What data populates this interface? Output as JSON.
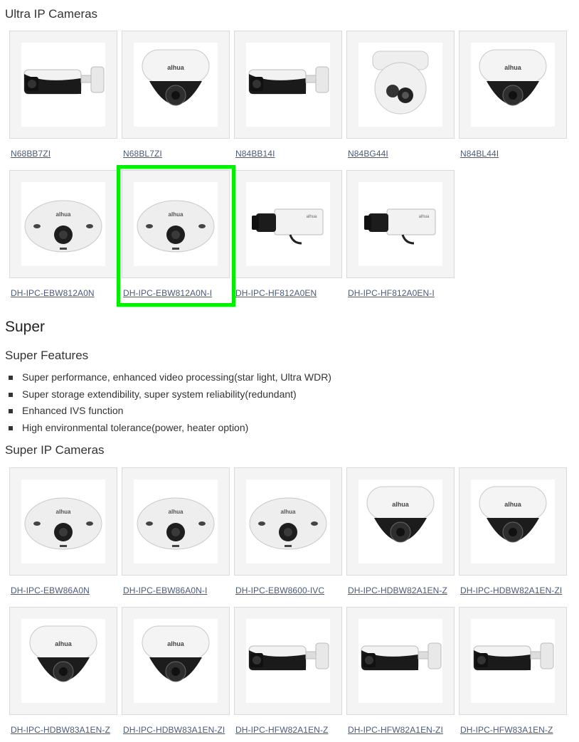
{
  "ultra": {
    "title": "Ultra IP Cameras",
    "cameras": [
      {
        "label": "N68BB7ZI",
        "icon": "bullet-camera-icon"
      },
      {
        "label": "N68BL7ZI",
        "icon": "dome-camera-icon"
      },
      {
        "label": "N84BB14I",
        "icon": "bullet-camera-icon"
      },
      {
        "label": "N84BG44I",
        "icon": "eyeball-camera-icon"
      },
      {
        "label": "N84BL44I",
        "icon": "dome-camera-icon"
      },
      {
        "label": "DH-IPC-EBW812A0N",
        "icon": "fisheye-camera-icon"
      },
      {
        "label": "DH-IPC-EBW812A0N-I",
        "icon": "fisheye-camera-icon"
      },
      {
        "label": "DH-IPC-HF812A0EN",
        "icon": "box-camera-icon"
      },
      {
        "label": "DH-IPC-HF812A0EN-I",
        "icon": "box-camera-icon"
      }
    ]
  },
  "super": {
    "heading": "Super",
    "features_title": "Super Features",
    "features": [
      "Super performance, enhanced video processing(star light, Ultra WDR)",
      "Super storage extendibility, super system reliability(redundant)",
      "Enhanced IVS function",
      "High environmental tolerance(power, heater option)"
    ],
    "cameras_title": "Super IP Cameras",
    "cameras": [
      {
        "label": "DH-IPC-EBW86A0N",
        "icon": "fisheye-camera-icon"
      },
      {
        "label": "DH-IPC-EBW86A0N-I",
        "icon": "fisheye-camera-icon"
      },
      {
        "label": "DH-IPC-EBW8600-IVC",
        "icon": "fisheye-camera-icon"
      },
      {
        "label": "DH-IPC-HDBW82A1EN-Z",
        "icon": "dome-camera-icon"
      },
      {
        "label": "DH-IPC-HDBW82A1EN-ZI",
        "icon": "dome-camera-icon"
      },
      {
        "label": "DH-IPC-HDBW83A1EN-Z",
        "icon": "dome-camera-icon"
      },
      {
        "label": "DH-IPC-HDBW83A1EN-ZI",
        "icon": "dome-camera-icon"
      },
      {
        "label": "DH-IPC-HFW82A1EN-Z",
        "icon": "bullet-camera-icon"
      },
      {
        "label": "DH-IPC-HFW82A1EN-ZI",
        "icon": "bullet-camera-icon"
      },
      {
        "label": "DH-IPC-HFW83A1EN-Z",
        "icon": "bullet-camera-icon"
      }
    ]
  },
  "brand_mark": "alhua",
  "colors": {
    "highlight": "#00ee00",
    "link": "#4a5a7a",
    "tile_border": "#d9d9d9",
    "tile_bg": "#f4f4f4"
  }
}
